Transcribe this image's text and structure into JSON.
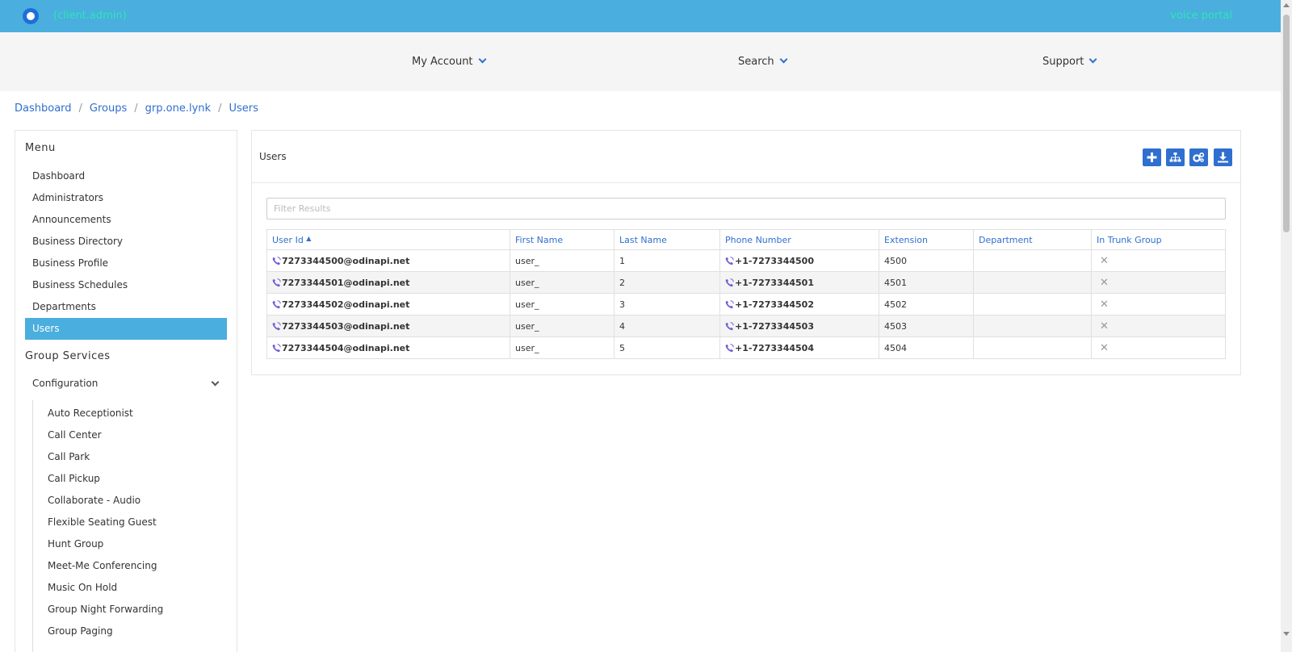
{
  "header": {
    "tenant": "(client.admin)",
    "portal": "voice portal"
  },
  "nav": [
    {
      "label": "My Account"
    },
    {
      "label": "Search"
    },
    {
      "label": "Support"
    }
  ],
  "breadcrumb": [
    "Dashboard",
    "Groups",
    "grp.one.lynk",
    "Users"
  ],
  "sidebar": {
    "menu_title": "Menu",
    "items": [
      "Dashboard",
      "Administrators",
      "Announcements",
      "Business Directory",
      "Business Profile",
      "Business Schedules",
      "Departments",
      "Users"
    ],
    "active_item": "Users",
    "group_services_title": "Group Services",
    "configuration_label": "Configuration",
    "sub_items": [
      "Auto Receptionist",
      "Call Center",
      "Call Park",
      "Call Pickup",
      "Collaborate - Audio",
      "Flexible Seating Guest",
      "Hunt Group",
      "Meet-Me Conferencing",
      "Music On Hold",
      "Group Night Forwarding",
      "Group Paging"
    ]
  },
  "panel": {
    "title": "Users",
    "toolbar_icons": [
      "add-icon",
      "sitemap-icon",
      "cogs-icon",
      "download-icon"
    ],
    "filter_placeholder": "Filter Results",
    "columns": [
      "User Id",
      "First Name",
      "Last Name",
      "Phone Number",
      "Extension",
      "Department",
      "In Trunk Group"
    ],
    "sort_indicator": "▲",
    "rows": [
      {
        "user_id": "7273344500@odinapi.net",
        "first_name": "user_",
        "last_name": "1",
        "phone": "+1-7273344500",
        "extension": "4500",
        "department": "",
        "in_trunk": "✕"
      },
      {
        "user_id": "7273344501@odinapi.net",
        "first_name": "user_",
        "last_name": "2",
        "phone": "+1-7273344501",
        "extension": "4501",
        "department": "",
        "in_trunk": "✕"
      },
      {
        "user_id": "7273344502@odinapi.net",
        "first_name": "user_",
        "last_name": "3",
        "phone": "+1-7273344502",
        "extension": "4502",
        "department": "",
        "in_trunk": "✕"
      },
      {
        "user_id": "7273344503@odinapi.net",
        "first_name": "user_",
        "last_name": "4",
        "phone": "+1-7273344503",
        "extension": "4503",
        "department": "",
        "in_trunk": "✕"
      },
      {
        "user_id": "7273344504@odinapi.net",
        "first_name": "user_",
        "last_name": "5",
        "phone": "+1-7273344504",
        "extension": "4504",
        "department": "",
        "in_trunk": "✕"
      }
    ]
  },
  "colors": {
    "header_bg": "#4aaede",
    "accent": "#2f6fcf",
    "tenant_text": "#2ee6b8",
    "active_item_bg": "#4aaede"
  }
}
